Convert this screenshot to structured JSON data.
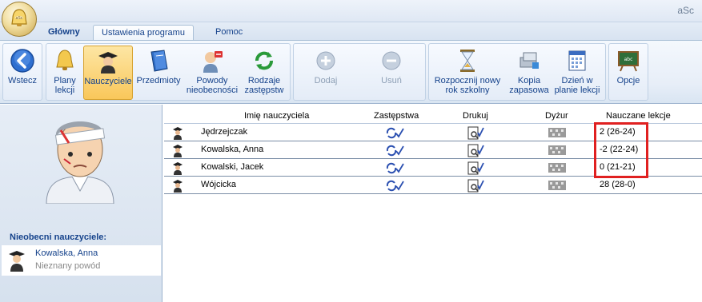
{
  "window": {
    "title": "aSc"
  },
  "tabs": [
    {
      "label": "Główny"
    },
    {
      "label": "Ustawienia programu"
    },
    {
      "label": "Pomoc"
    }
  ],
  "ribbon": {
    "back": "Wstecz",
    "plans": "Plany lekcji",
    "teachers": "Nauczyciele",
    "subjects": "Przedmioty",
    "reasons": "Powody nieobecności",
    "types": "Rodzaje zastępstw",
    "add": "Dodaj",
    "remove": "Usuń",
    "new_year": "Rozpocznij nowy rok szkolny",
    "backup": "Kopia zapasowa",
    "day_plan": "Dzień w planie lekcji",
    "options": "Opcje"
  },
  "absent": {
    "label": "Nieobecni nauczyciele:",
    "items": [
      {
        "name": "Kowalska, Anna",
        "reason": "Nieznany powód"
      }
    ]
  },
  "grid": {
    "columns": [
      "Imię nauczyciela",
      "Zastępstwa",
      "Drukuj",
      "Dyżur",
      "Nauczane lekcje"
    ],
    "rows": [
      {
        "name": "Jędrzejczak",
        "lessons": "2 (26-24)"
      },
      {
        "name": "Kowalska, Anna",
        "lessons": "-2 (22-24)"
      },
      {
        "name": "Kowalski, Jacek",
        "lessons": "0 (21-21)"
      },
      {
        "name": "Wójcicka",
        "lessons": "28 (28-0)"
      }
    ]
  },
  "colors": {
    "accent": "#15428b",
    "highlight": "#e02020",
    "selected": "#f9c75a"
  },
  "icons": {
    "teacher": "teacher-icon",
    "substitution": "substitution-icon",
    "print": "print-icon",
    "duty": "duty-icon"
  }
}
